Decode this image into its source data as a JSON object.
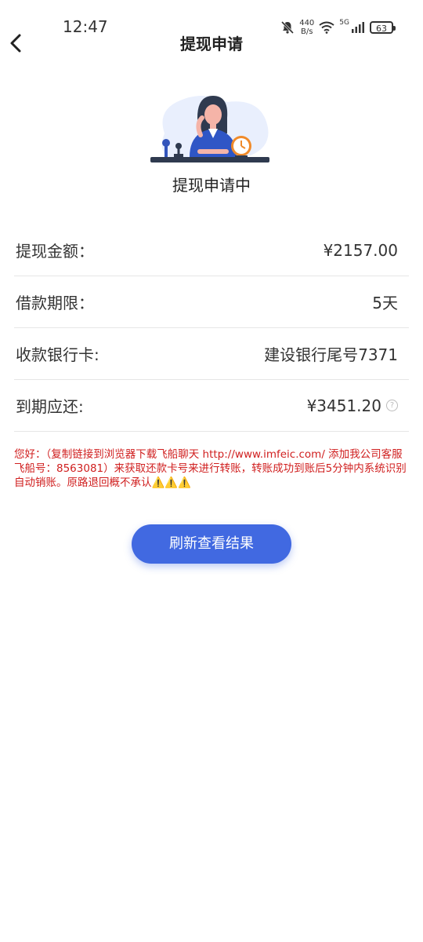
{
  "status_bar": {
    "time": "12:47",
    "network_speed_value": "440",
    "network_speed_unit": "B/s",
    "signal_type": "5G",
    "battery": "63"
  },
  "header": {
    "title": "提现申请"
  },
  "status": {
    "text": "提现申请中"
  },
  "info_rows": [
    {
      "label": "提现金额：",
      "value": "¥2157.00"
    },
    {
      "label": "借款期限：",
      "value": "5天"
    },
    {
      "label": "收款银行卡:",
      "value": "建设银行尾号7371"
    },
    {
      "label": "到期应还:",
      "value": "¥3451.20"
    }
  ],
  "notice": {
    "text": "您好：（复制链接到浏览器下载飞船聊天 http://www.imfeic.com/ 添加我公司客服飞船号：8563081）来获取还款卡号来进行转账，转账成功到账后5分钟内系统识别自动销账。原路退回概不承认⚠️⚠️⚠️"
  },
  "actions": {
    "refresh_label": "刷新查看结果"
  },
  "colors": {
    "accent": "#4169e1",
    "notice": "#d01f1f"
  }
}
